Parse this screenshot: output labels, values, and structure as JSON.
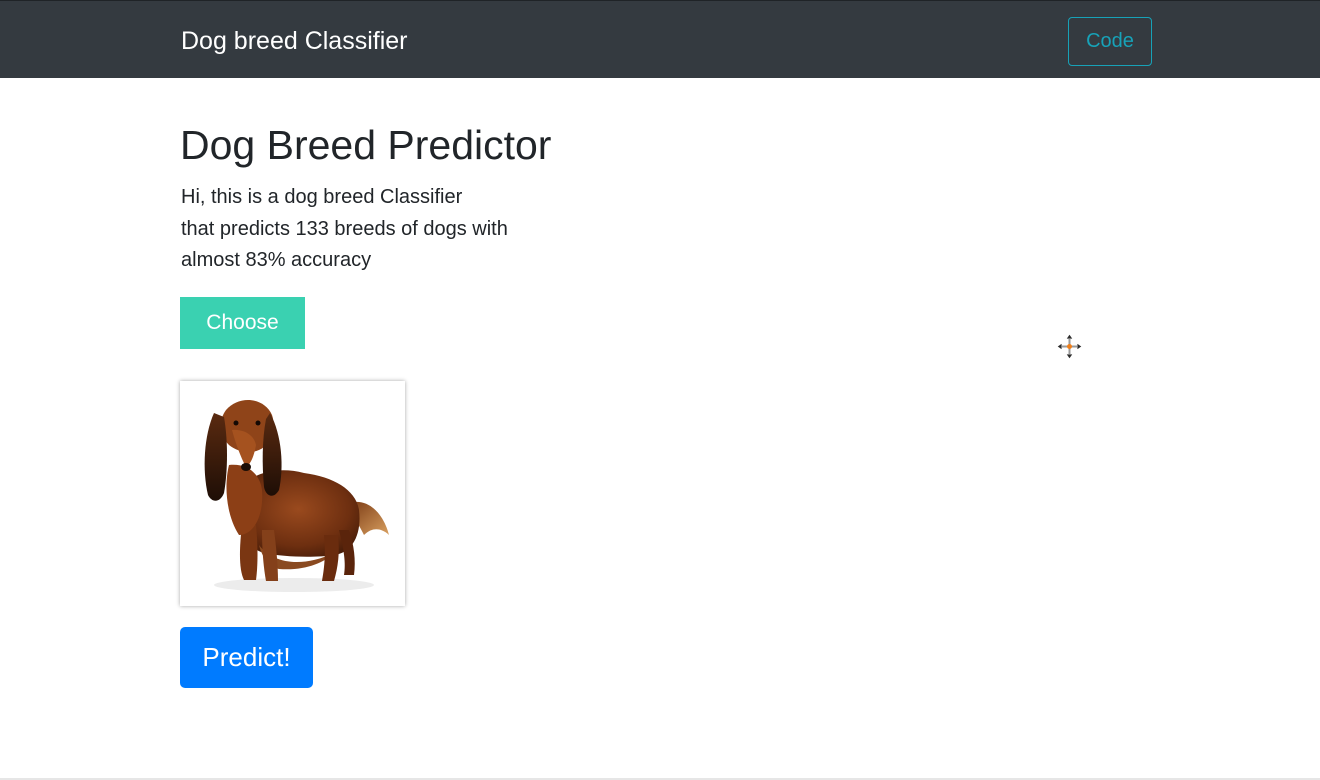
{
  "navbar": {
    "brand": "Dog breed Classifier",
    "code_label": "Code",
    "bg_color": "#343a40",
    "code_color": "#17a2b8"
  },
  "main": {
    "title": "Dog Breed Predictor",
    "description_lines": [
      "Hi, this is a dog breed Classifier",
      "that predicts 133 breeds of dogs with",
      "almost 83% accuracy"
    ],
    "choose_label": "Choose",
    "choose_color": "#3ad1b1",
    "preview_icon": "dog-photo",
    "predict_label": "Predict!",
    "predict_color": "#007bff"
  },
  "cursor": {
    "icon": "move-cursor-icon"
  }
}
